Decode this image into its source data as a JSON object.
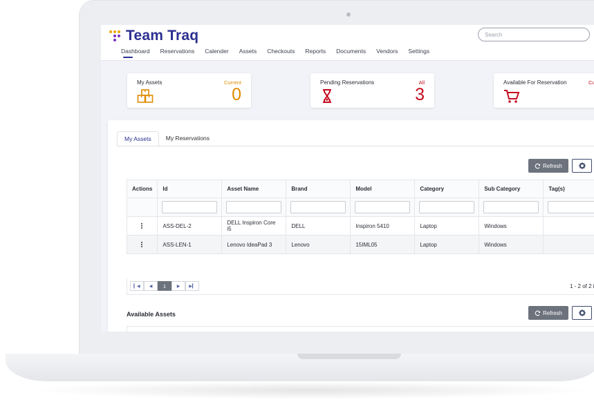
{
  "app": {
    "name": "Team Traq"
  },
  "search": {
    "placeholder": "Search"
  },
  "nav": {
    "items": [
      "Dashboard",
      "Reservations",
      "Calender",
      "Assets",
      "Checkouts",
      "Reports",
      "Documents",
      "Vendors",
      "Settings"
    ],
    "active": "Dashboard"
  },
  "cards": [
    {
      "title": "My Assets",
      "sub": "Current",
      "value": "0",
      "icon": "boxes-icon",
      "color": "#e08a00"
    },
    {
      "title": "Pending Reservations",
      "sub": "All",
      "value": "3",
      "icon": "hourglass-icon",
      "color": "#c40d1f"
    },
    {
      "title": "Available For Reservation",
      "sub": "Cu",
      "value": "",
      "icon": "cart-icon",
      "color": "#c40d1f"
    }
  ],
  "tabs": [
    "My Assets",
    "My Reservations"
  ],
  "toolbar": {
    "refresh_label": "Refresh"
  },
  "table": {
    "columns": [
      "Actions",
      "Id",
      "Asset Name",
      "Brand",
      "Model",
      "Category",
      "Sub Category",
      "Tag(s)"
    ],
    "rows": [
      {
        "id": "ASS-DEL-2",
        "name": "DELL Inspiron Core i5",
        "brand": "DELL",
        "model": "Inspiron 5410",
        "category": "Laptop",
        "sub": "Windows",
        "tags": ""
      },
      {
        "id": "ASS-LEN-1",
        "name": "Lenovo IdeaPad 3",
        "brand": "Lenovo",
        "model": "15IML05",
        "category": "Laptop",
        "sub": "Windows",
        "tags": ""
      }
    ]
  },
  "pager": {
    "current": "1",
    "info": "1 - 2 of 2 i"
  },
  "available": {
    "title": "Available Assets"
  },
  "colors": {
    "brand": "#2b2f8f",
    "accent_orange": "#e08a00",
    "accent_red": "#c40d1f",
    "button_gray": "#6c737d"
  }
}
